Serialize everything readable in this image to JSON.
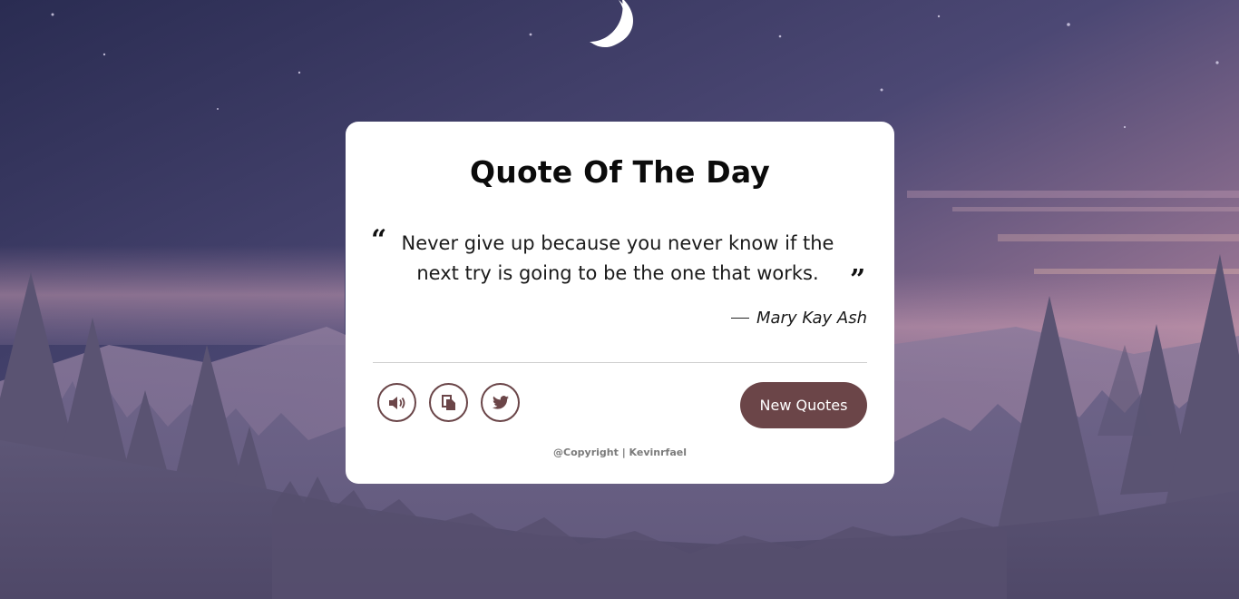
{
  "card": {
    "title": "Quote Of The Day",
    "quote_text": "Never give up because you never know if the next try is going to be the one that works.",
    "author": "Mary Kay Ash",
    "new_quote_label": "New Quotes",
    "copyright": "@Copyright | Kevinrfael"
  },
  "actions": {
    "speech_icon": "volume-icon",
    "copy_icon": "copy-icon",
    "twitter_icon": "twitter-icon"
  },
  "colors": {
    "accent": "#6b4548",
    "card_bg": "#ffffff"
  }
}
